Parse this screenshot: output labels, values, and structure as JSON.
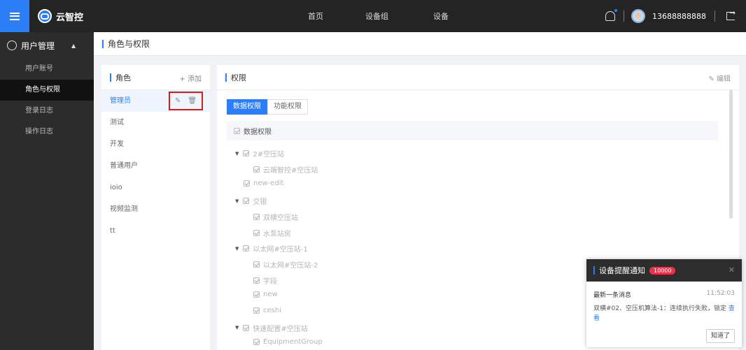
{
  "app": {
    "title": "云智控"
  },
  "topnav": [
    "首页",
    "设备组",
    "设备"
  ],
  "user": {
    "phone": "13688888888"
  },
  "sidebar": {
    "group": "用户管理",
    "items": [
      {
        "label": "用户账号",
        "active": false
      },
      {
        "label": "角色与权限",
        "active": true
      },
      {
        "label": "登录日志",
        "active": false
      },
      {
        "label": "操作日志",
        "active": false
      }
    ]
  },
  "breadcrumb": "角色与权限",
  "roles": {
    "title": "角色",
    "add_label": "+ 添加",
    "items": [
      "管理员",
      "测试",
      "开发",
      "普通用户",
      "ioio",
      "视频监测",
      "tt"
    ]
  },
  "permissions": {
    "title": "权限",
    "edit_label": "编辑",
    "tabs": [
      "数据权限",
      "功能权限"
    ],
    "tree_header": "数据权限",
    "tree": [
      {
        "label": "2#空压站",
        "level": 0,
        "expand": true
      },
      {
        "label": "云端智控#空压站",
        "level": 1
      },
      {
        "label": "new-edit",
        "level": 0
      },
      {
        "label": "交银",
        "level": 0,
        "expand": true
      },
      {
        "label": "双横空压站",
        "level": 1
      },
      {
        "label": "水泵站房",
        "level": 1
      },
      {
        "label": "以太网#空压站-1",
        "level": 0,
        "expand": true
      },
      {
        "label": "以太网#空压站-2",
        "level": 1
      },
      {
        "label": "字段",
        "level": 1
      },
      {
        "label": "new",
        "level": 1
      },
      {
        "label": "ceshi",
        "level": 1
      },
      {
        "label": "快速配置#空压站",
        "level": 0,
        "expand": true
      },
      {
        "label": "EquipmentGroup",
        "level": 1
      }
    ]
  },
  "notification": {
    "title": "设备提醒通知",
    "badge": "10000",
    "subtitle": "最新一条消息",
    "time": "11:52:03",
    "message": "双横#02、空压机算法-1：连续执行失败，锁定",
    "link": "查看",
    "button": "知道了"
  },
  "colors": {
    "accent": "#2b7ef5",
    "highlight_box": "#e01818",
    "badge": "#e8334a"
  }
}
